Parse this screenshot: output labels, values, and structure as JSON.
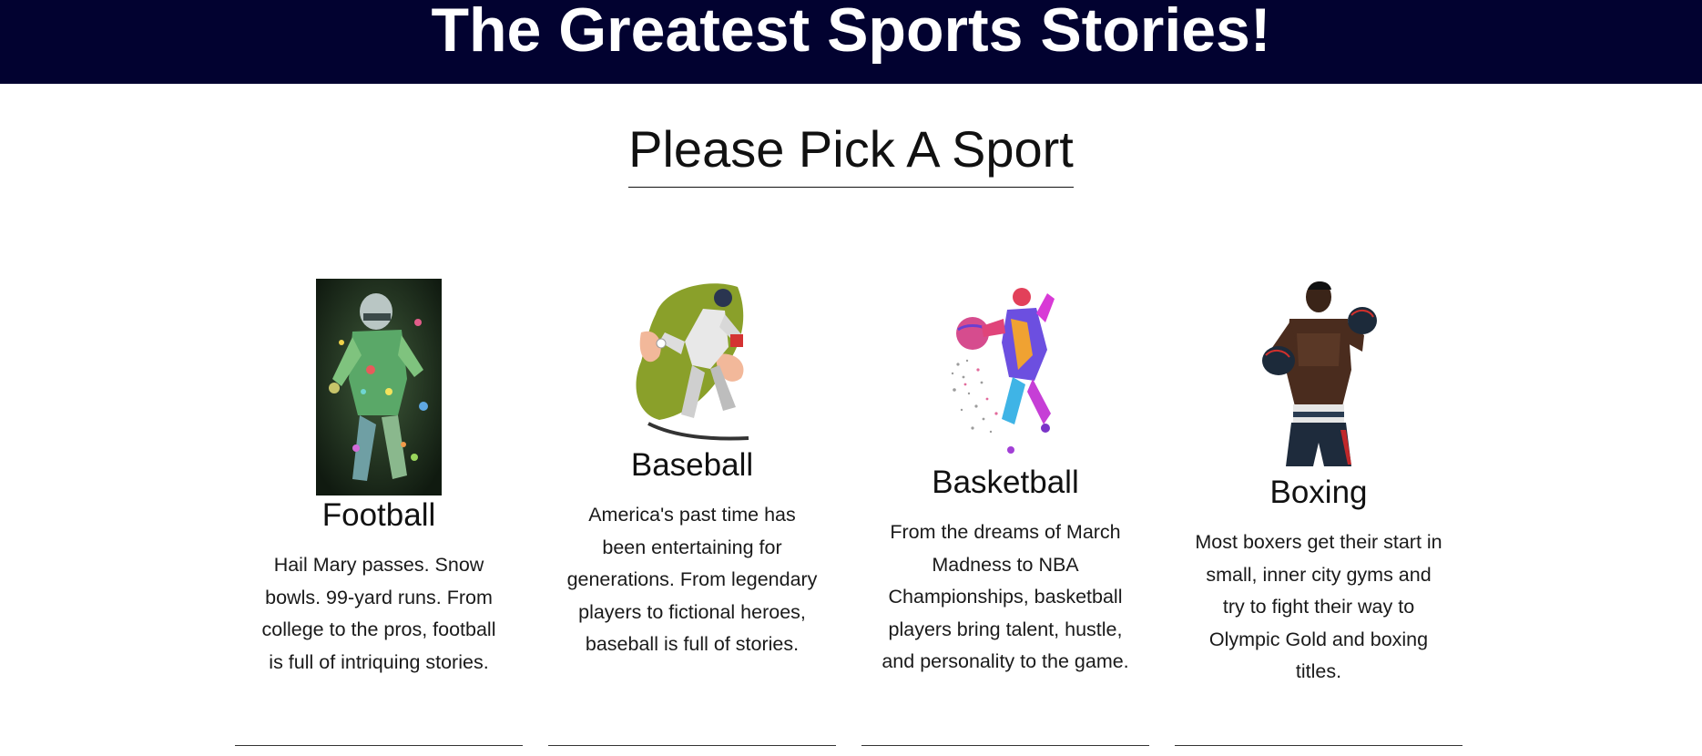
{
  "header": {
    "title": "The Greatest Sports Stories!"
  },
  "main": {
    "heading": "Please Pick A Sport"
  },
  "colors": {
    "header_bg": "#020230",
    "header_text": "#ffffff",
    "text": "#111111"
  },
  "sports": [
    {
      "title": "Football",
      "description": "Hail Mary passes. Snow bowls. 99-yard runs. From college to the pros, football is full of intriquing stories.",
      "image_icon": "football-player-illustration"
    },
    {
      "title": "Baseball",
      "description": "America's past time has been entertaining for generations. From legendary players to fictional heroes, baseball is full of stories.",
      "image_icon": "baseball-pitcher-illustration"
    },
    {
      "title": "Basketball",
      "description": "From the dreams of March Madness to NBA Championships, basketball players bring talent, hustle, and personality to the game.",
      "image_icon": "basketball-player-illustration"
    },
    {
      "title": "Boxing",
      "description": "Most boxers get their start in small, inner city gyms and try to fight their way to Olympic Gold and boxing titles.",
      "image_icon": "boxer-illustration"
    }
  ]
}
